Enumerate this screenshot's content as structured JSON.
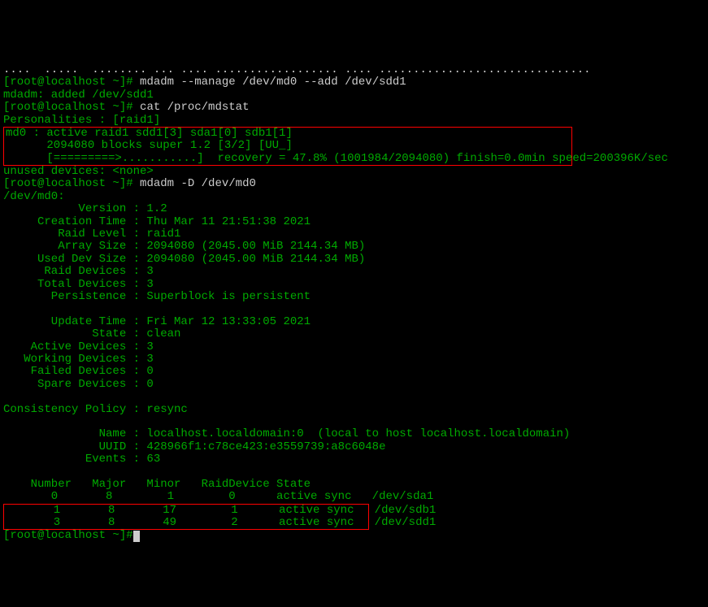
{
  "top_line": "....  .....  ........ ... .... .................. .... ...............................",
  "cmd1_prompt": "[root@localhost ~]#",
  "cmd1": " mdadm --manage /dev/md0 --add /dev/sdd1",
  "mdadm_added": "mdadm: added /dev/sdd1",
  "cmd2_prompt": "[root@localhost ~]#",
  "cmd2": " cat /proc/mdstat",
  "personalities": "Personalities : [raid1]",
  "mdstat_line1": "md0 : active raid1 sdd1[3] sda1[0] sdb1[1]",
  "mdstat_line2": "      2094080 blocks super 1.2 [3/2] [UU_]",
  "mdstat_line3": "      [=========>...........]  recovery = 47.8% (1001984/2094080) finish=0.0min speed=200396K/sec",
  "unused_devices": "unused devices: <none>",
  "cmd3_prompt": "[root@localhost ~]#",
  "cmd3": " mdadm -D /dev/md0",
  "dev_md0": "/dev/md0:",
  "version": "           Version : 1.2",
  "creation_time": "     Creation Time : Thu Mar 11 21:51:38 2021",
  "raid_level": "        Raid Level : raid1",
  "array_size": "        Array Size : 2094080 (2045.00 MiB 2144.34 MB)",
  "used_dev_size": "     Used Dev Size : 2094080 (2045.00 MiB 2144.34 MB)",
  "raid_devices": "      Raid Devices : 3",
  "total_devices": "     Total Devices : 3",
  "persistence": "       Persistence : Superblock is persistent",
  "update_time": "       Update Time : Fri Mar 12 13:33:05 2021",
  "state": "             State : clean",
  "active_devices": "    Active Devices : 3",
  "working_devices": "   Working Devices : 3",
  "failed_devices": "    Failed Devices : 0",
  "spare_devices": "     Spare Devices : 0",
  "consistency_policy": "Consistency Policy : resync",
  "name": "              Name : localhost.localdomain:0  (local to host localhost.localdomain)",
  "uuid": "              UUID : 428966f1:c78ce423:e3559739:a8c6048e",
  "events": "            Events : 63",
  "table_header": "    Number   Major   Minor   RaidDevice State",
  "table_row0": "       0       8        1        0      active sync   /dev/sda1",
  "table_row1": "       1       8       17        1      active sync   /dev/sdb1",
  "table_row2": "       3       8       49        2      active sync   /dev/sdd1",
  "cmd4_prompt": "[root@localhost ~]#"
}
